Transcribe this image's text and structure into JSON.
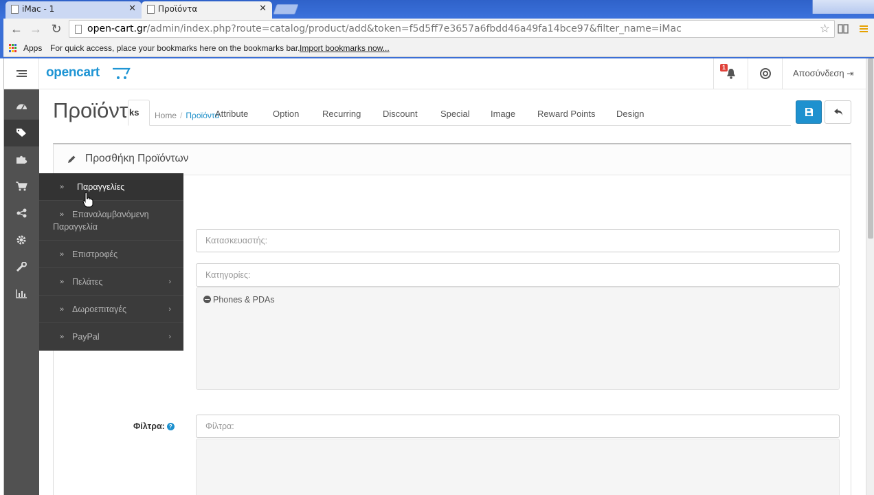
{
  "browser": {
    "tabs": [
      {
        "label": "iMac - 1",
        "active": false
      },
      {
        "label": "Προϊόντα",
        "active": true
      }
    ],
    "url_host": "open-cart.gr",
    "url_path": "/admin/index.php?route=catalog/product/add&token=f5d5ff7e3657a6fbdd46a49fa14bce97&filter_name=iMac",
    "bookmarks_bar": {
      "apps_label": "Apps",
      "hint": "For quick access, place your bookmarks here on the bookmarks bar.",
      "import_link": "Import bookmarks now..."
    }
  },
  "header": {
    "logo": "opencart",
    "notification_count": "1",
    "logout_label": "Αποσύνδεση"
  },
  "sidebar": {
    "icons": [
      "dashboard-icon",
      "tags-icon",
      "puzzle-icon",
      "cart-icon",
      "share-icon",
      "gear-icon",
      "wrench-icon",
      "bar-chart-icon"
    ],
    "active_index": 1
  },
  "flyout_menu": {
    "items": [
      {
        "label": "Παραγγελίες",
        "has_children": false
      },
      {
        "label_line1": "Επαναλαμβανόμενη",
        "label_line2": "Παραγγελία",
        "has_children": false
      },
      {
        "label": "Επιστροφές",
        "has_children": false
      },
      {
        "label": "Πελάτες",
        "has_children": true
      },
      {
        "label": "Δωροεπιταγές",
        "has_children": true
      },
      {
        "label": "PayPal",
        "has_children": true
      }
    ]
  },
  "page": {
    "title": "Προϊόντα",
    "breadcrumb": {
      "home": "Home",
      "current": "Προϊόντα"
    }
  },
  "panel": {
    "title": "Προσθήκη Προϊόντων",
    "tabs": {
      "active_fragment": "ks",
      "items": [
        "Attribute",
        "Option",
        "Recurring",
        "Discount",
        "Special",
        "Image",
        "Reward Points",
        "Design"
      ]
    },
    "fields": {
      "manufacturer_placeholder": "Κατασκευαστής:",
      "categories_placeholder": "Κατηγορίες:",
      "selected_category": "Phones & PDAs",
      "filters_label": "Φίλτρα:",
      "filters_placeholder": "Φίλτρα:"
    }
  },
  "colors": {
    "accent": "#1e91cf",
    "sidebar": "#515151",
    "flyout": "#3b3b3b",
    "badge": "#e0423a"
  }
}
